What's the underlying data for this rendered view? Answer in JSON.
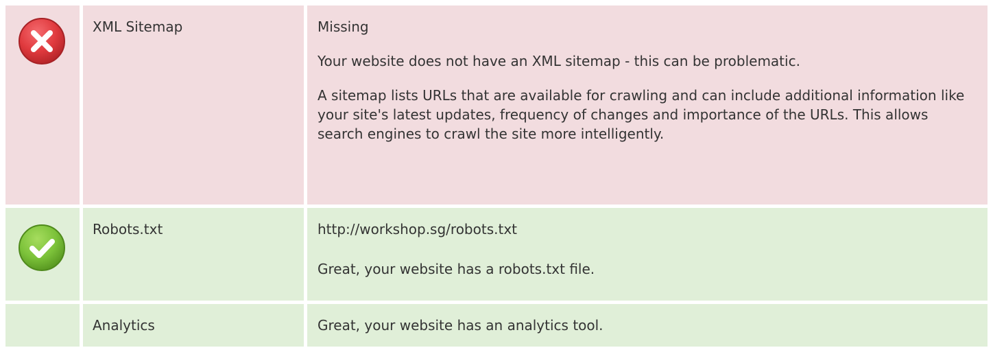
{
  "checks": [
    {
      "status": "error",
      "icon": "error-x-icon",
      "name": "XML Sitemap",
      "value": "Missing",
      "details": [
        "Your website does not have an XML sitemap - this can be problematic.",
        "A sitemap lists URLs that are available for crawling and can include additional information like your site's latest updates, frequency of changes and importance of the URLs. This allows search engines to crawl the site more intelligently."
      ]
    },
    {
      "status": "success",
      "icon": "success-check-icon",
      "name": "Robots.txt",
      "value": "http://workshop.sg/robots.txt",
      "details": [
        "Great, your website has a robots.txt file."
      ]
    },
    {
      "status": "success",
      "icon": "",
      "name": "Analytics",
      "value": "Great, your website has an analytics tool.",
      "details": []
    }
  ],
  "colors": {
    "error_bg": "#f2dcdf",
    "success_bg": "#e0efd8",
    "error_icon": "#e03a3e",
    "success_icon": "#7cc23a"
  }
}
